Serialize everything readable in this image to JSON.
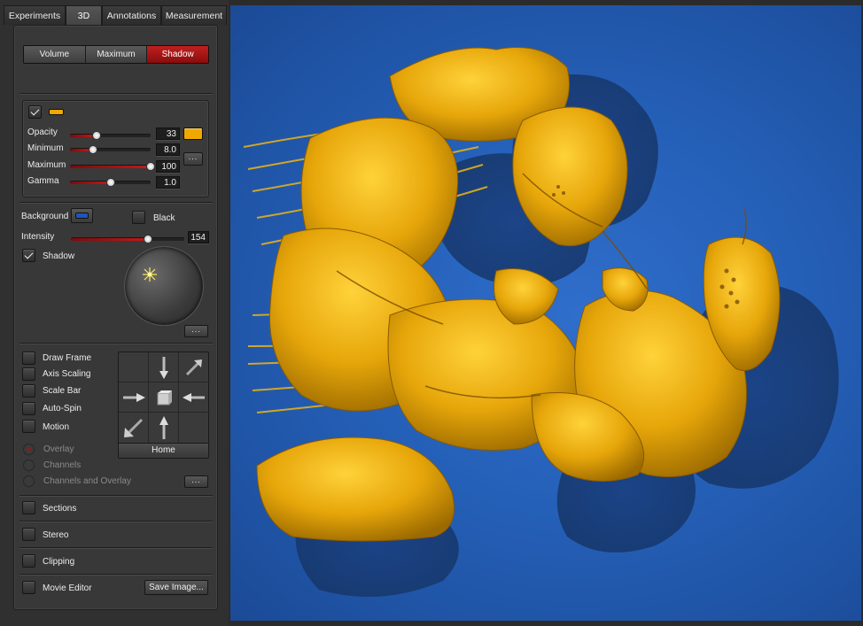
{
  "tabs": [
    "Experiments",
    "3D",
    "Annotations",
    "Measurement"
  ],
  "active_tab": "3D",
  "render_modes": [
    "Volume",
    "Maximum",
    "Shadow"
  ],
  "active_render_mode": "Shadow",
  "channel": {
    "enabled": true,
    "color": "#f0a800",
    "params": [
      {
        "label": "Opacity",
        "value": "33",
        "fraction": 0.33
      },
      {
        "label": "Minimum",
        "value": "8.0",
        "fraction": 0.29
      },
      {
        "label": "Maximum",
        "value": "100",
        "fraction": 1.0
      },
      {
        "label": "Gamma",
        "value": "1.0",
        "fraction": 0.51
      }
    ],
    "more_button": "..."
  },
  "background": {
    "label": "Background",
    "color": "#1e55b8",
    "black_label": "Black",
    "black_checked": false
  },
  "intensity": {
    "label": "Intensity",
    "value": "154",
    "fraction": 0.68
  },
  "shadow": {
    "label": "Shadow",
    "checked": true,
    "more_button": "..."
  },
  "options": [
    {
      "label": "Draw Frame",
      "checked": false
    },
    {
      "label": "Axis Scaling",
      "checked": false
    },
    {
      "label": "Scale Bar",
      "checked": false
    },
    {
      "label": "Auto-Spin",
      "checked": false
    },
    {
      "label": "Motion",
      "checked": false
    }
  ],
  "motion_modes": [
    {
      "label": "Overlay",
      "selected": true
    },
    {
      "label": "Channels",
      "selected": false
    },
    {
      "label": "Channels and Overlay",
      "selected": false
    }
  ],
  "motion_more_button": "...",
  "nav": {
    "home_label": "Home"
  },
  "sections": [
    {
      "label": "Sections",
      "checked": false
    },
    {
      "label": "Stereo",
      "checked": false
    },
    {
      "label": "Clipping",
      "checked": false
    },
    {
      "label": "Movie Editor",
      "checked": false
    }
  ],
  "save_image_label": "Save Image..."
}
